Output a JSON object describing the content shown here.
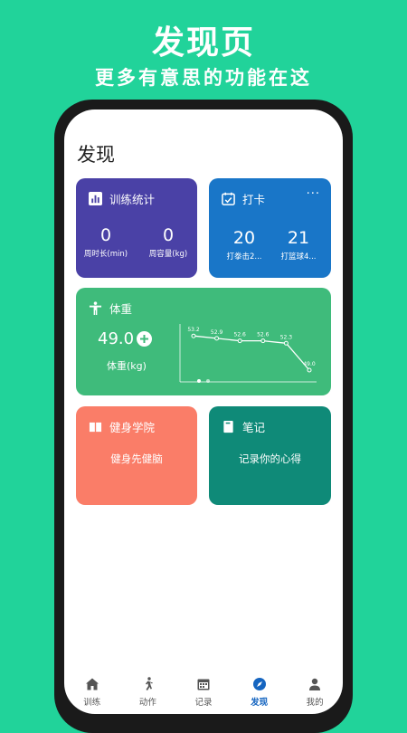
{
  "promo": {
    "title": "发现页",
    "subtitle": "更多有意思的功能在这"
  },
  "page": {
    "title": "发现"
  },
  "training_stats": {
    "title": "训练统计",
    "color": "#4a41a6",
    "stats": [
      {
        "value": "0",
        "label": "周时长(min)"
      },
      {
        "value": "0",
        "label": "周容量(kg)"
      }
    ]
  },
  "checkin": {
    "title": "打卡",
    "more": "···",
    "color": "#1976c8",
    "stats": [
      {
        "value": "20",
        "label": "打拳击2..."
      },
      {
        "value": "21",
        "label": "打篮球4..."
      }
    ]
  },
  "weight": {
    "title": "体重",
    "value": "49.0",
    "add_icon": "plus-icon",
    "label": "体重(kg)",
    "color": "#3fbb7b",
    "chart_data": {
      "type": "line",
      "values": [
        53.2,
        52.9,
        52.6,
        52.6,
        52.3,
        49.0
      ],
      "labels": [
        "53.2",
        "52.9",
        "52.6",
        "52.6",
        "52.3",
        "49.0"
      ],
      "ylim": [
        48,
        54
      ]
    },
    "pager": {
      "count": 2,
      "active": 0
    }
  },
  "academy": {
    "title": "健身学院",
    "subtitle": "健身先健脑",
    "color": "#fa7d68"
  },
  "notes": {
    "title": "笔记",
    "subtitle": "记录你的心得",
    "color": "#0f8a78"
  },
  "nav": [
    {
      "label": "训练",
      "icon": "home-icon",
      "active": false
    },
    {
      "label": "动作",
      "icon": "runner-icon",
      "active": false
    },
    {
      "label": "记录",
      "icon": "calendar-icon",
      "active": false
    },
    {
      "label": "发现",
      "icon": "compass-icon",
      "active": true
    },
    {
      "label": "我的",
      "icon": "person-icon",
      "active": false
    }
  ]
}
